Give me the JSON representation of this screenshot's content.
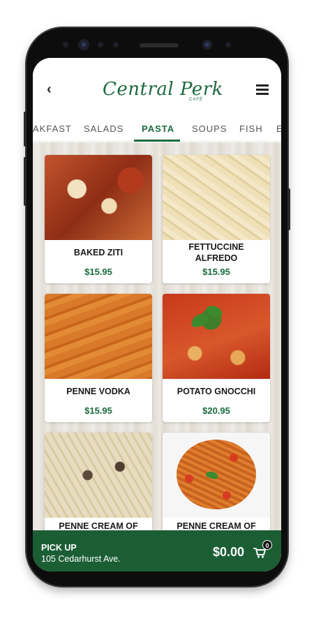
{
  "header": {
    "logo_text": "Central Perk",
    "logo_sub": "CAFÉ"
  },
  "tabs": [
    {
      "label": "AKFAST"
    },
    {
      "label": "SALADS"
    },
    {
      "label": "PASTA",
      "active": true
    },
    {
      "label": "SOUPS"
    },
    {
      "label": "FISH"
    },
    {
      "label": "E"
    }
  ],
  "menu_items": [
    {
      "name": "BAKED ZITI",
      "price": "$15.95"
    },
    {
      "name": "FETTUCCINE ALFREDO",
      "price": "$15.95"
    },
    {
      "name": "PENNE VODKA",
      "price": "$15.95"
    },
    {
      "name": "POTATO GNOCCHI",
      "price": "$20.95"
    },
    {
      "name": "PENNE CREAM OF",
      "price": ""
    },
    {
      "name": "PENNE CREAM OF",
      "price": ""
    }
  ],
  "footer": {
    "pickup_title": "PICK UP",
    "pickup_address": "105 Cedarhurst Ave.",
    "total": "$0.00",
    "cart_count": "0"
  },
  "colors": {
    "brand_green": "#1b6a3f",
    "footer_green": "#1c5e34"
  }
}
